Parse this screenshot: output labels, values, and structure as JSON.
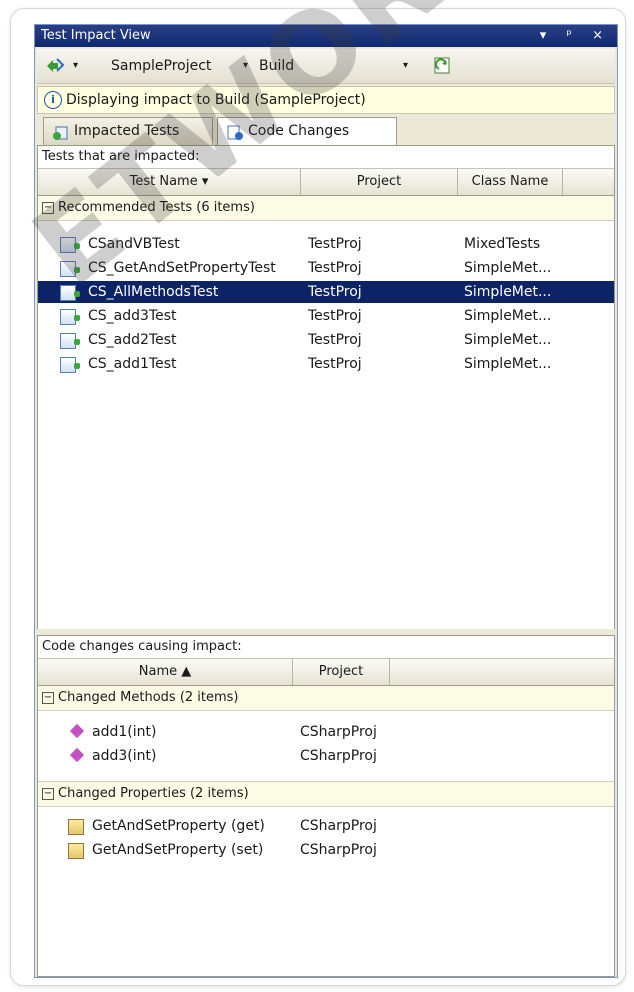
{
  "window": {
    "title": "Test Impact View",
    "controls": {
      "dropdown": "▾",
      "pin": "ᵖ",
      "close": "×"
    }
  },
  "toolbar": {
    "nav_icon": "back-forward-icon",
    "project_select": "SampleProject",
    "build_select": "Build",
    "refresh_icon": "refresh-icon"
  },
  "info": {
    "icon": "info-icon",
    "text": "Displaying impact to Build (SampleProject)"
  },
  "tabs": [
    {
      "label": "Impacted Tests",
      "active": true
    },
    {
      "label": "Code Changes",
      "active": false
    }
  ],
  "impacted": {
    "title": "Tests that are impacted:",
    "columns": [
      "Test Name ▾",
      "Project",
      "Class Name"
    ],
    "group": "Recommended Tests (6 items)",
    "rows": [
      {
        "name": "CSandVBTest",
        "project": "TestProj",
        "class": "MixedTests",
        "selected": false
      },
      {
        "name": "CS_GetAndSetPropertyTest",
        "project": "TestProj",
        "class": "SimpleMet...",
        "selected": false
      },
      {
        "name": "CS_AllMethodsTest",
        "project": "TestProj",
        "class": "SimpleMet...",
        "selected": true
      },
      {
        "name": "CS_add3Test",
        "project": "TestProj",
        "class": "SimpleMet...",
        "selected": false
      },
      {
        "name": "CS_add2Test",
        "project": "TestProj",
        "class": "SimpleMet...",
        "selected": false
      },
      {
        "name": "CS_add1Test",
        "project": "TestProj",
        "class": "SimpleMet...",
        "selected": false
      }
    ]
  },
  "changes": {
    "title": "Code changes causing impact:",
    "columns": [
      "Name ▲",
      "Project"
    ],
    "methods_group": "Changed Methods (2 items)",
    "methods": [
      {
        "name": "add1(int)",
        "project": "CSharpProj"
      },
      {
        "name": "add3(int)",
        "project": "CSharpProj"
      }
    ],
    "properties_group": "Changed Properties (2 items)",
    "properties": [
      {
        "name": "GetAndSetProperty (get)",
        "project": "CSharpProj"
      },
      {
        "name": "GetAndSetProperty (set)",
        "project": "CSharpProj"
      }
    ]
  },
  "watermark": "ETWORK"
}
